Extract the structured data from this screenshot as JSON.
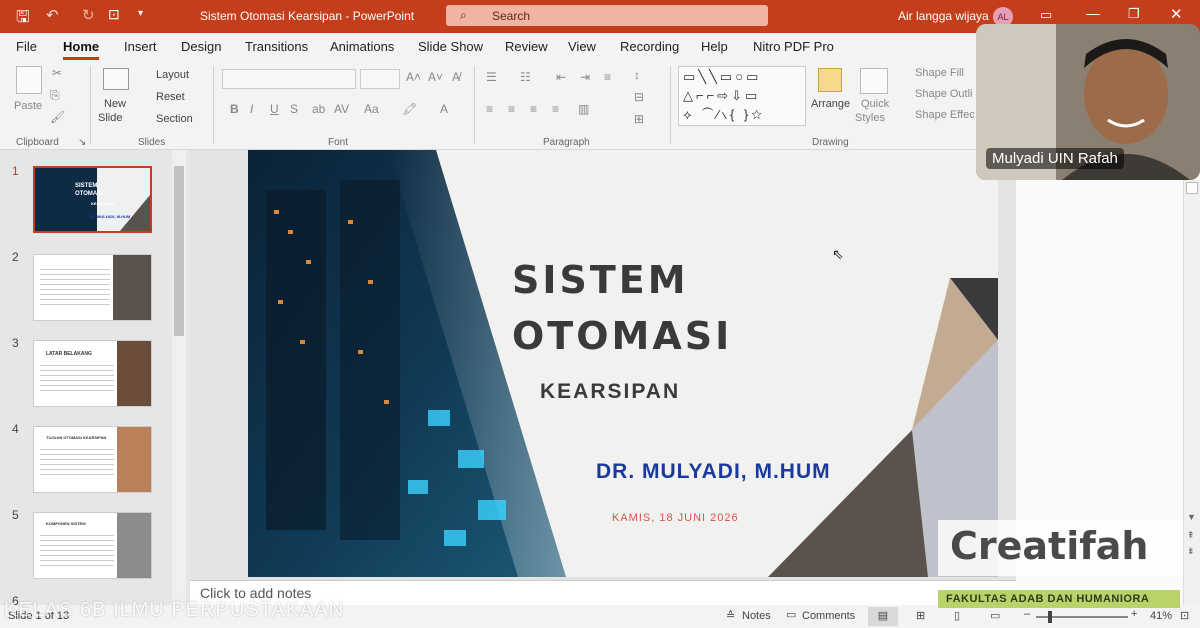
{
  "titlebar": {
    "doc_title": "Sistem Otomasi Kearsipan - PowerPoint",
    "search_placeholder": "Search",
    "user_name": "Air langga wijaya",
    "user_initials": "AL"
  },
  "tabs": [
    "File",
    "Home",
    "Insert",
    "Design",
    "Transitions",
    "Animations",
    "Slide Show",
    "Review",
    "View",
    "Recording",
    "Help",
    "Nitro PDF Pro"
  ],
  "active_tab": "Home",
  "ribbon": {
    "clipboard": {
      "label": "Clipboard",
      "paste": "Paste"
    },
    "slides": {
      "label": "Slides",
      "new_slide": "New",
      "new_slide2": "Slide",
      "layout": "Layout",
      "reset": "Reset",
      "section": "Section"
    },
    "font": {
      "label": "Font"
    },
    "paragraph": {
      "label": "Paragraph"
    },
    "drawing": {
      "label": "Drawing",
      "arrange": "Arrange",
      "quick_styles": "Quick",
      "quick_styles2": "Styles",
      "shape_fill": "Shape Fill",
      "shape_outline": "Shape Outli",
      "shape_effects": "Shape Effec"
    }
  },
  "slide_numbers": [
    "1",
    "2",
    "3",
    "4",
    "5",
    "6"
  ],
  "thumb_titles": [
    "SISTEM",
    "OTOMASI",
    "KEARSIPAN",
    "DR. MULYADI, M.HUM",
    "LATAR BELAKANG",
    "TUJUAN OTOMASI KEARSIPAN",
    "KOMPONEN SISTEM"
  ],
  "slide": {
    "title1": "SISTEM",
    "title2": "OTOMASI",
    "subtitle": "KEARSIPAN",
    "author": "DR. MULYADI, M.HUM",
    "date": "KAMIS, 18 JUNI 2026"
  },
  "notes_placeholder": "Click to add notes",
  "status": {
    "slide_of": "Slide 1 of 13",
    "class_overlay": "KELAS 6B ILMU PERPUSTAKAAN",
    "notes": "Notes",
    "comments": "Comments",
    "zoom": "41%"
  },
  "camera_name": "Mulyadi UIN Rafah",
  "watermark": "Creatifah",
  "faculty_banner": "FAKULTAS ADAB DAN HUMANIORA",
  "colors": {
    "titlebar": "#c43e1c",
    "accent_blue": "#1b3a9e",
    "title_text": "#3a3a3c",
    "date_red": "#d9534f",
    "banner_green": "#b8d36a"
  }
}
